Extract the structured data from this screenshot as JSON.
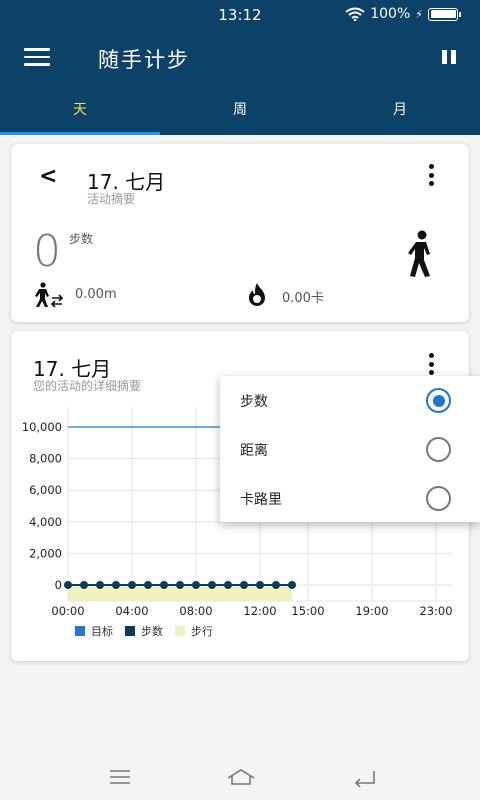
{
  "status": {
    "time": "13:12",
    "battery": "100%",
    "battery_level": 1.0
  },
  "appbar": {
    "title": "随手计步",
    "menu_icon": "hamburger-menu-icon",
    "pause_icon": "pause-icon"
  },
  "tabs": [
    {
      "label": "天",
      "active": true
    },
    {
      "label": "周",
      "active": false
    },
    {
      "label": "月",
      "active": false
    }
  ],
  "summary": {
    "date": "17. 七月",
    "subtitle": "活动摘要",
    "steps": "0",
    "steps_label": "步数",
    "distance": "0.00m",
    "calories": "0.00卡"
  },
  "detail": {
    "date": "17. 七月",
    "subtitle": "您的活动的详细摘要"
  },
  "colors": {
    "primary": "#0c4267",
    "accent_tab": "#f6e05a",
    "goal": "#1f78c8",
    "steps": "#0d3b5c",
    "walking": "#eef2c3"
  },
  "chart_data": {
    "type": "line",
    "yticks": [
      "10,000",
      "8,000",
      "6,000",
      "4,000",
      "2,000",
      "0"
    ],
    "ylim": [
      0,
      11000
    ],
    "xticks": [
      "00:00",
      "04:00",
      "08:00",
      "12:00",
      "15:00",
      "19:00",
      "23:00"
    ],
    "xlim": [
      0,
      24
    ],
    "series": [
      {
        "name": "目标",
        "color": "#1f78c8",
        "x": [
          0,
          13.5
        ],
        "y": [
          10000,
          10000
        ]
      },
      {
        "name": "步数",
        "color": "#0d3b5c",
        "x": [
          0,
          1,
          2,
          3,
          4,
          5,
          6,
          7,
          8,
          9,
          10,
          11,
          12,
          13,
          14
        ],
        "y": [
          0,
          0,
          0,
          0,
          0,
          0,
          0,
          0,
          0,
          0,
          0,
          0,
          0,
          0,
          0
        ]
      },
      {
        "name": "步行",
        "color": "#eef2c3",
        "x": [
          0,
          14
        ],
        "y": [
          0,
          0
        ]
      }
    ]
  },
  "popup": {
    "options": [
      {
        "label": "步数",
        "selected": true
      },
      {
        "label": "距离",
        "selected": false
      },
      {
        "label": "卡路里",
        "selected": false
      }
    ]
  }
}
